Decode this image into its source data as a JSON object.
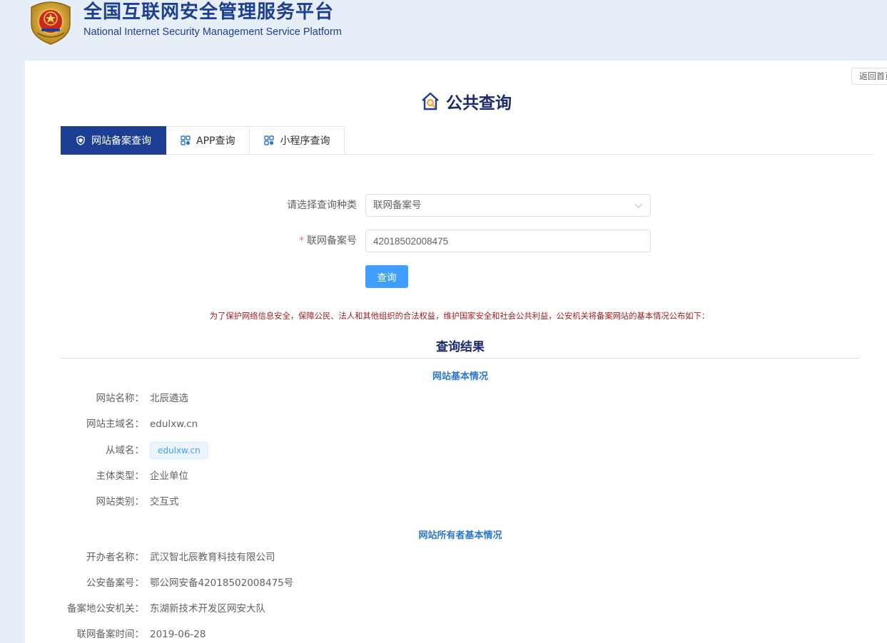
{
  "header": {
    "title": "全国互联网安全管理服务平台",
    "subtitle": "National Internet Security Management Service Platform",
    "emblem_icon": "police-emblem-icon"
  },
  "toolbar": {
    "back_label": "返回首页"
  },
  "page": {
    "title": "公共查询",
    "title_icon": "house-search-icon"
  },
  "tabs": [
    {
      "label": "网站备案查询",
      "icon": "shield-icon",
      "active": true
    },
    {
      "label": "APP查询",
      "icon": "grid-icon",
      "active": false
    },
    {
      "label": "小程序查询",
      "icon": "grid-icon",
      "active": false
    }
  ],
  "form": {
    "type_label": "请选择查询种类",
    "type_value": "联网备案号",
    "number_label": "联网备案号",
    "number_value": "42018502008475",
    "required_mark": "*",
    "query_label": "查询"
  },
  "notice": "为了保护网络信息安全，保障公民、法人和其他组织的合法权益，维护国家安全和社会公共利益，公安机关将备案网站的基本情况公布如下：",
  "result": {
    "title": "查询结果",
    "site_section": {
      "title": "网站基本情况",
      "rows": [
        {
          "label": "网站名称：",
          "value": "北辰遴选"
        },
        {
          "label": "网站主域名：",
          "value": "edulxw.cn"
        },
        {
          "label": "从域名：",
          "value": "edulxw.cn"
        },
        {
          "label": "主体类型：",
          "value": "企业单位"
        },
        {
          "label": "网站类别：",
          "value": "交互式"
        }
      ]
    },
    "owner_section": {
      "title": "网站所有者基本情况",
      "rows": [
        {
          "label": "开办者名称：",
          "value": "武汉智北辰教育科技有限公司"
        },
        {
          "label": "公安备案号：",
          "value": "鄂公网安备42018502008475号"
        },
        {
          "label": "备案地公安机关：",
          "value": "东湖新技术开发区网安大队"
        },
        {
          "label": "联网备案时间：",
          "value": "2019-06-28"
        }
      ]
    }
  },
  "colors": {
    "brand": "#1c3f94",
    "primary": "#409eff",
    "notice": "#a11e1e",
    "section": "#2f77c9"
  }
}
